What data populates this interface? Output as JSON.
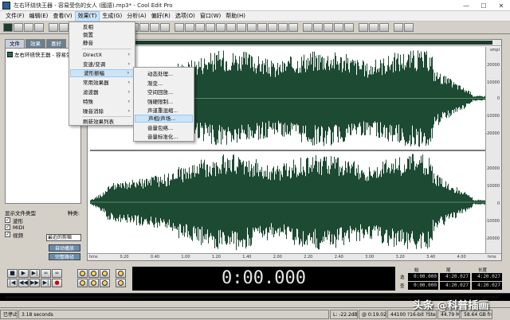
{
  "window": {
    "title": "左右环绕快王器 - 容易受伤的女人 (國語).mp3* - Cool Edit Pro",
    "min": "—",
    "max": "☐",
    "close": "✕"
  },
  "menubar": {
    "items": [
      "文件(F)",
      "编辑(E)",
      "查看(V)",
      "效果(T)",
      "生成(G)",
      "分析(A)",
      "偏好(R)",
      "选项(O)",
      "窗口(W)",
      "帮助(H)"
    ],
    "active": "效果(T)"
  },
  "effects_menu": {
    "items": [
      {
        "label": "反相",
        "submenu": false
      },
      {
        "label": "倒置",
        "submenu": false
      },
      {
        "label": "静音",
        "submenu": false
      },
      {
        "label": "DirectX",
        "submenu": true
      },
      {
        "label": "变速/变调",
        "submenu": true
      },
      {
        "label": "波形振幅",
        "submenu": true,
        "highlighted": true
      },
      {
        "label": "常用效果器",
        "submenu": true
      },
      {
        "label": "滤波器",
        "submenu": true
      },
      {
        "label": "特殊",
        "submenu": true
      },
      {
        "label": "噪音消除",
        "submenu": true
      },
      {
        "label": "刷新效果列表",
        "submenu": false
      }
    ]
  },
  "amplitude_submenu": {
    "items": [
      {
        "label": "动态处理..."
      },
      {
        "label": "渐变..."
      },
      {
        "label": "空间回放..."
      },
      {
        "label": "强硬限制..."
      },
      {
        "label": "声道重混缩..."
      },
      {
        "label": "声相/声场...",
        "highlighted": true
      },
      {
        "label": "音量包络..."
      },
      {
        "label": "音量标准化..."
      }
    ]
  },
  "left_panel": {
    "tabs": [
      "文件",
      "效果",
      "喜好"
    ],
    "active_tab": "文件",
    "files": [
      "左右环绕快王器 - 容易受伤的女人 (國語).mp3"
    ],
    "file_type_label": "显示文件类型",
    "sort_label": "种类:",
    "sort_value": "最近的剪辑",
    "types": [
      {
        "label": "波形",
        "checked": true
      },
      {
        "label": "MIDI",
        "checked": true
      },
      {
        "label": "视频",
        "checked": true
      }
    ],
    "buttons": [
      "自动播放",
      "完整路径"
    ]
  },
  "waveform": {
    "vruler_labels": [
      "smpl",
      "20000",
      "10000",
      "0",
      "-10000",
      "-20000"
    ],
    "hruler_labels": [
      "hms",
      "0.20",
      "0.40",
      "1.00",
      "1.20",
      "1.40",
      "2.00",
      "2.20",
      "2.40",
      "3.00",
      "3.20",
      "3.40",
      "4.00",
      "hms"
    ],
    "wave_color": "#1c4a32"
  },
  "time_display": "0:00.000",
  "selection_info": {
    "headers": [
      "始",
      "尾",
      "长度"
    ],
    "row_labels": [
      "选",
      "查"
    ],
    "select_values": [
      "0:00.000",
      "4:20.027",
      "4:20.027"
    ],
    "view_values": [
      "0:00.000",
      "4:20.027",
      "4:20.027"
    ]
  },
  "status_bar": {
    "state": "已停止",
    "duration": "3.18 seconds",
    "level": "L: -22.2dB",
    "position": "@ 0:19.029",
    "format": "44100 ?16-bit ?Stereo",
    "size": "44.79 MB",
    "free": "58.64 GB free"
  },
  "watermark": "头条 @科普插画"
}
